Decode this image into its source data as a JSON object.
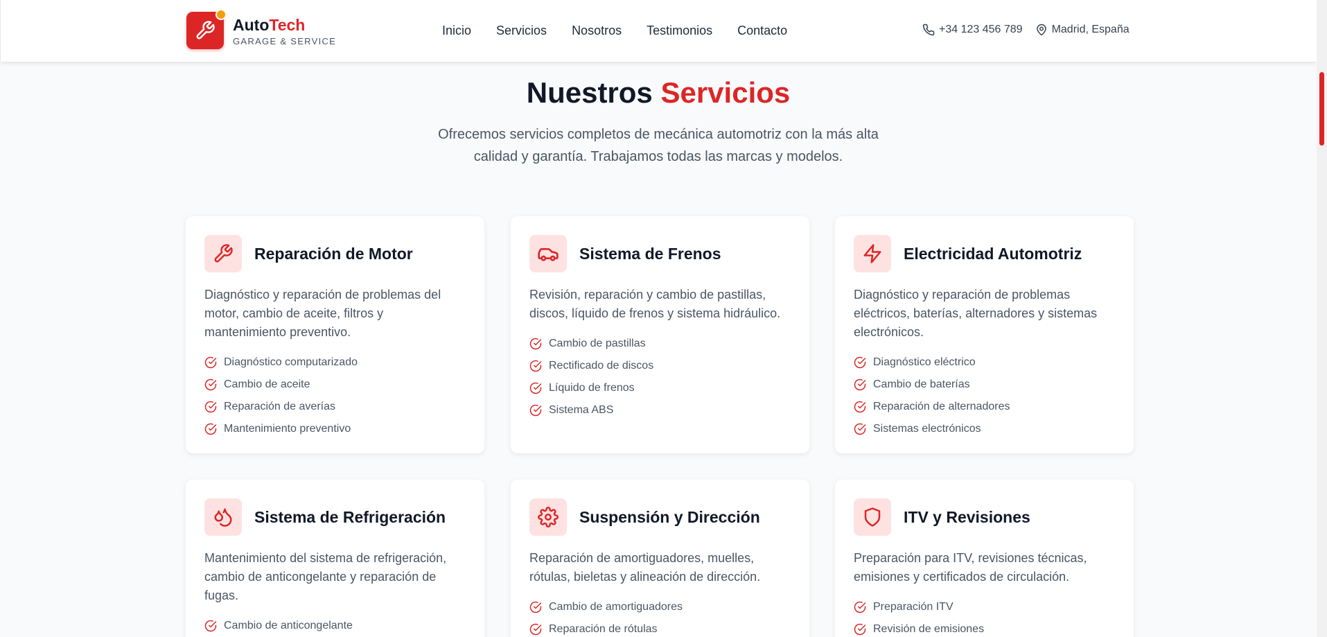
{
  "header": {
    "brand_part1": "Auto",
    "brand_part2": "Tech",
    "brand_sub": "GARAGE & SERVICE",
    "nav": [
      "Inicio",
      "Servicios",
      "Nosotros",
      "Testimonios",
      "Contacto"
    ],
    "phone": "+34 123 456 789",
    "location": "Madrid, España"
  },
  "section": {
    "title_part1": "Nuestros",
    "title_part2": "Servicios",
    "intro": "Ofrecemos servicios completos de mecánica automotriz con la más alta calidad y garantía. Trabajamos todas las marcas y modelos."
  },
  "services": [
    {
      "icon": "wrench-icon",
      "title": "Reparación de Motor",
      "description": "Diagnóstico y reparación de problemas del motor, cambio de aceite, filtros y mantenimiento preventivo.",
      "features": [
        "Diagnóstico computarizado",
        "Cambio de aceite",
        "Reparación de averías",
        "Mantenimiento preventivo"
      ]
    },
    {
      "icon": "car-icon",
      "title": "Sistema de Frenos",
      "description": "Revisión, reparación y cambio de pastillas, discos, líquido de frenos y sistema hidráulico.",
      "features": [
        "Cambio de pastillas",
        "Rectificado de discos",
        "Líquido de frenos",
        "Sistema ABS"
      ]
    },
    {
      "icon": "lightning-icon",
      "title": "Electricidad Automotriz",
      "description": "Diagnóstico y reparación de problemas eléctricos, baterías, alternadores y sistemas electrónicos.",
      "features": [
        "Diagnóstico eléctrico",
        "Cambio de baterías",
        "Reparación de alternadores",
        "Sistemas electrónicos"
      ]
    },
    {
      "icon": "droplets-icon",
      "title": "Sistema de Refrigeración",
      "description": "Mantenimiento del sistema de refrigeración, cambio de anticongelante y reparación de fugas.",
      "features": [
        "Cambio de anticongelante"
      ]
    },
    {
      "icon": "gear-icon",
      "title": "Suspensión y Dirección",
      "description": "Reparación de amortiguadores, muelles, rótulas, bieletas y alineación de dirección.",
      "features": [
        "Cambio de amortiguadores",
        "Reparación de rótulas"
      ]
    },
    {
      "icon": "shield-icon",
      "title": "ITV y Revisiones",
      "description": "Preparación para ITV, revisiones técnicas, emisiones y certificados de circulación.",
      "features": [
        "Preparación ITV",
        "Revisión de emisiones"
      ]
    }
  ],
  "colors": {
    "accent": "#dc2626",
    "icon_bg": "#fee2e2",
    "page_bg": "#f8fafc"
  }
}
